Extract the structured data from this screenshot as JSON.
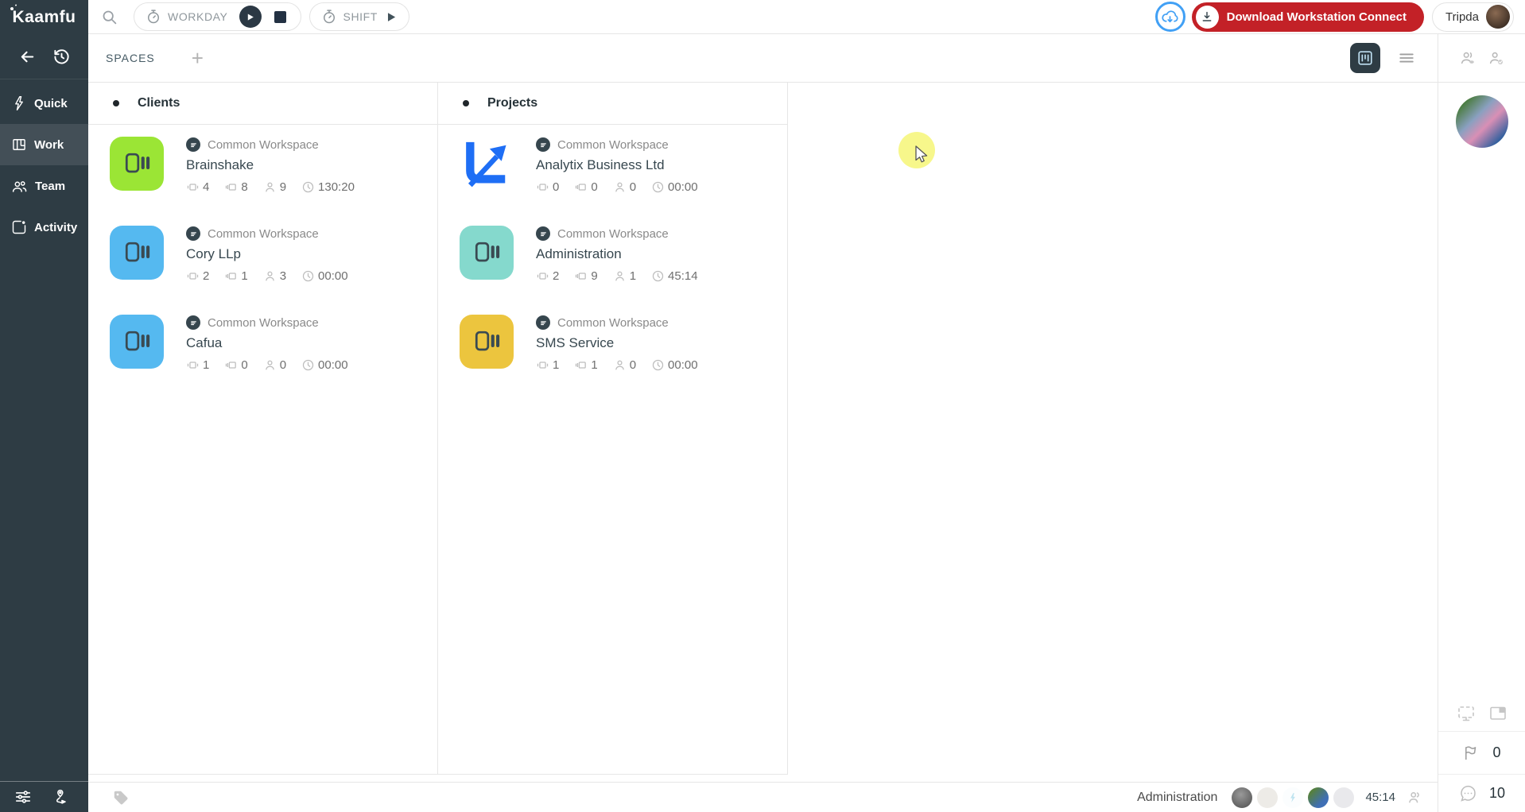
{
  "colors": {
    "sidebar_bg": "#2e3c44",
    "brand_red": "#c32127",
    "accent_blue": "#3d9df5",
    "highlight_yellow": "#f6f67e"
  },
  "topbar": {
    "logo": "Kaamfu",
    "workday_label": "WORKDAY",
    "shift_label": "SHIFT",
    "download_label": "Download Workstation Connect",
    "user_name": "Tripda"
  },
  "sidebar": {
    "active_item": "Work",
    "items": [
      {
        "label": "Quick"
      },
      {
        "label": "Work"
      },
      {
        "label": "Team"
      },
      {
        "label": "Activity"
      }
    ]
  },
  "toolbar": {
    "spaces_label": "SPACES",
    "add_label": "+"
  },
  "board": {
    "columns": [
      {
        "title": "Clients",
        "cards": [
          {
            "workspace": "Common Workspace",
            "title": "Brainshake",
            "tile_color": "#9be535",
            "stats": {
              "screens": "4",
              "boards": "8",
              "members": "9",
              "time": "130:20"
            }
          },
          {
            "workspace": "Common Workspace",
            "title": "Cory LLp",
            "tile_color": "#55b9f0",
            "stats": {
              "screens": "2",
              "boards": "1",
              "members": "3",
              "time": "00:00"
            }
          },
          {
            "workspace": "Common Workspace",
            "title": "Cafua",
            "tile_color": "#55b9f0",
            "stats": {
              "screens": "1",
              "boards": "0",
              "members": "0",
              "time": "00:00"
            }
          }
        ]
      },
      {
        "title": "Projects",
        "cards": [
          {
            "workspace": "Common Workspace",
            "title": "Analytix Business Ltd",
            "tile_color": "#ffffff",
            "logo": "analytix-chart-logo",
            "stats": {
              "screens": "0",
              "boards": "0",
              "members": "0",
              "time": "00:00"
            }
          },
          {
            "workspace": "Common Workspace",
            "title": "Administration",
            "tile_color": "#85d9cd",
            "stats": {
              "screens": "2",
              "boards": "9",
              "members": "1",
              "time": "45:14"
            }
          },
          {
            "workspace": "Common Workspace",
            "title": "SMS Service",
            "tile_color": "#ecc53e",
            "stats": {
              "screens": "1",
              "boards": "1",
              "members": "0",
              "time": "00:00"
            }
          }
        ]
      }
    ]
  },
  "statusbar": {
    "workspace_label": "Administration",
    "timer": "45:14",
    "flag_count": "0",
    "chat_count": "10"
  }
}
